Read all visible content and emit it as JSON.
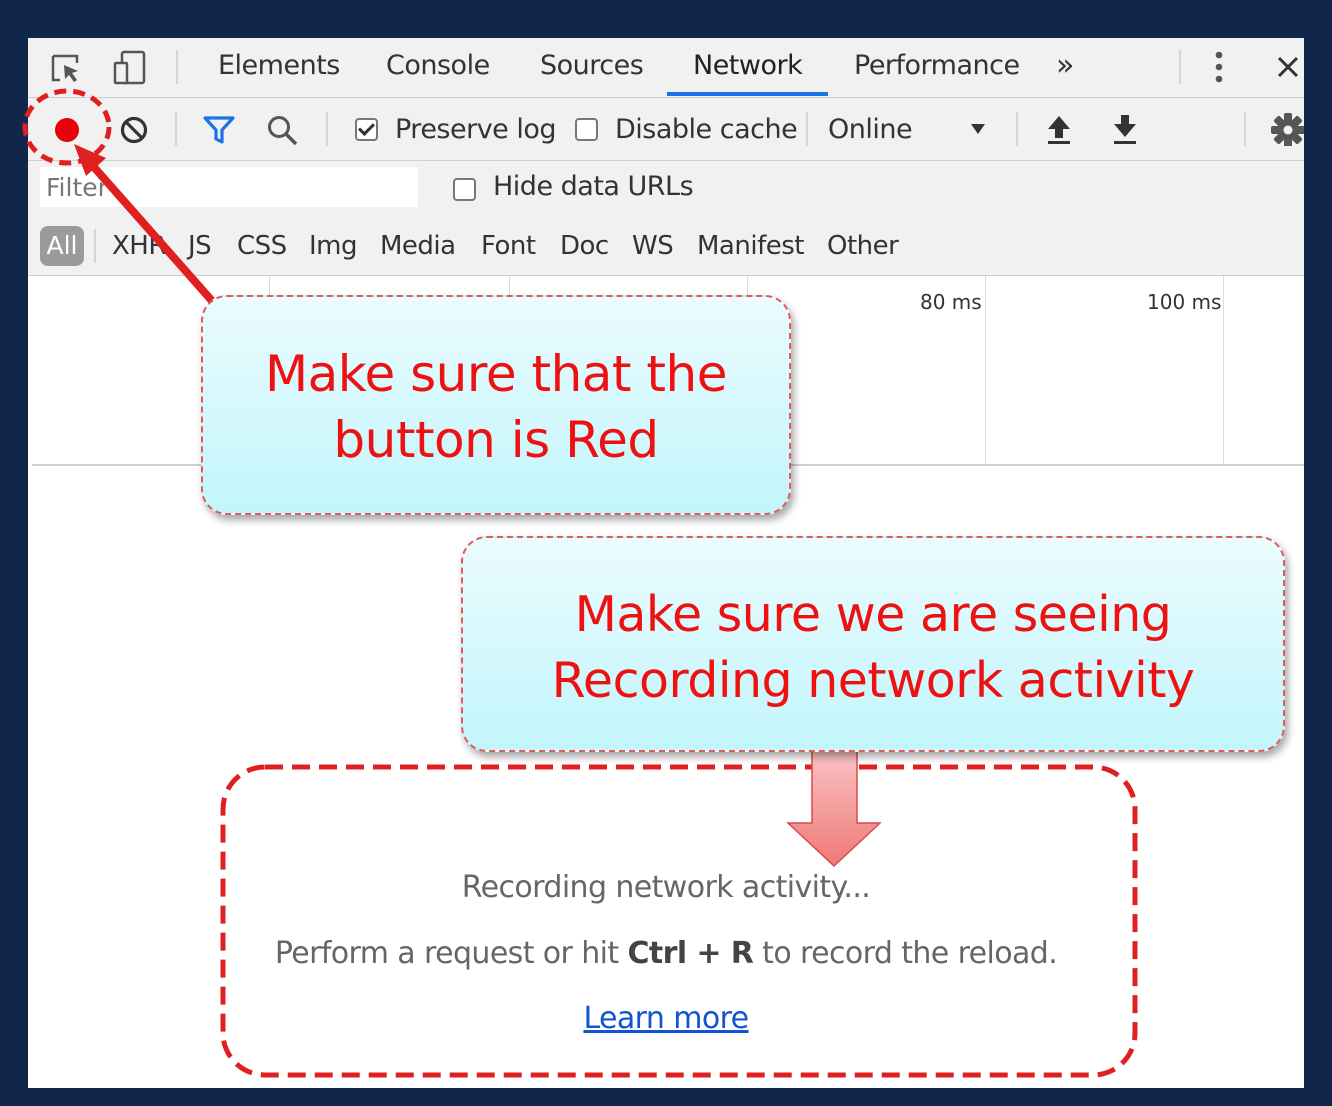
{
  "tabs": {
    "items": [
      "Elements",
      "Console",
      "Sources",
      "Network",
      "Performance"
    ],
    "active": "Network",
    "more_label": "»"
  },
  "toolbar": {
    "preserve_log_label": "Preserve log",
    "preserve_log_checked": true,
    "disable_cache_label": "Disable cache",
    "disable_cache_checked": false,
    "throttling_value": "Online"
  },
  "filter": {
    "placeholder": "Filter",
    "hide_data_urls_label": "Hide data URLs",
    "hide_data_urls_checked": false
  },
  "types": [
    "All",
    "XHR",
    "JS",
    "CSS",
    "Img",
    "Media",
    "Font",
    "Doc",
    "WS",
    "Manifest",
    "Other"
  ],
  "timeline": {
    "ticks": [
      "80 ms",
      "100 ms"
    ]
  },
  "empty_state": {
    "title": "Recording network activity...",
    "hint_prefix": "Perform a request or hit ",
    "hint_keys": "Ctrl + R",
    "hint_suffix": " to record the reload.",
    "link": "Learn more"
  },
  "annotations": {
    "callout_1_line1": "Make sure that the",
    "callout_1_line2": "button is Red",
    "callout_2_line1": "Make sure we are seeing",
    "callout_2_line2": "Recording network activity",
    "accent_color": "#e02020"
  },
  "colors": {
    "record_button": "#e8000b",
    "frame": "#10264a",
    "active_tab_underline": "#1a73e8",
    "filter_icon": "#1a73e8"
  }
}
